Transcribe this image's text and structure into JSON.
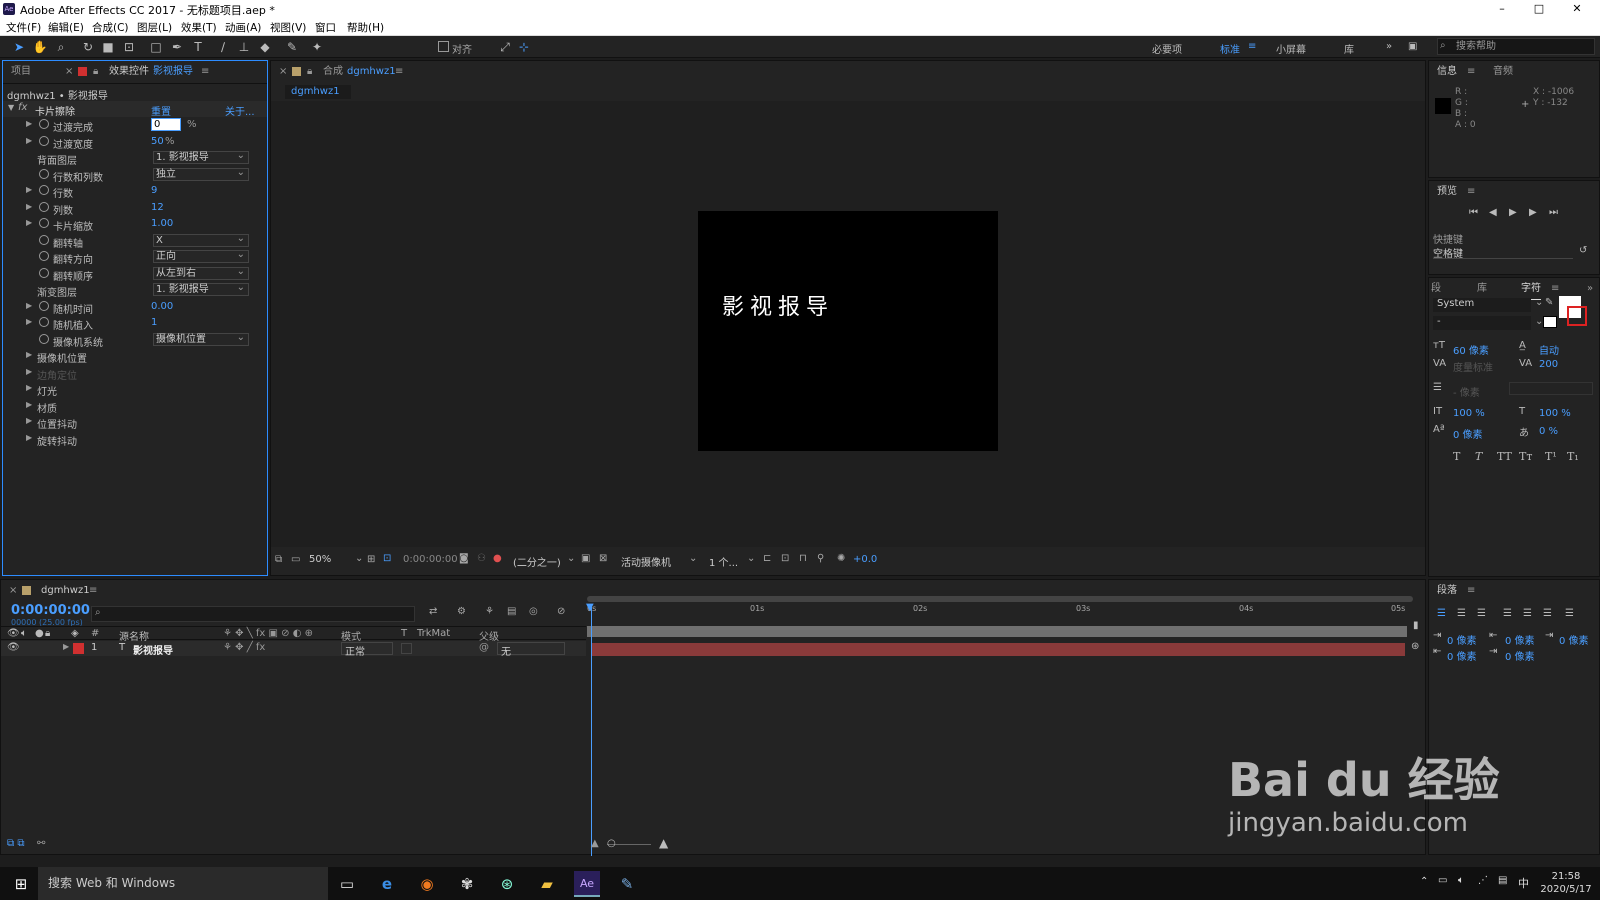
{
  "window": {
    "title": "Adobe After Effects CC 2017 - 无标题项目.aep *",
    "app_icon": "Ae",
    "min": "–",
    "max": "□",
    "close": "✕"
  },
  "menu": [
    "文件(F)",
    "编辑(E)",
    "合成(C)",
    "图层(L)",
    "效果(T)",
    "动画(A)",
    "视图(V)",
    "窗口",
    "帮助(H)"
  ],
  "toolbar": {
    "snap_label": "对齐",
    "workspaces": [
      "必要项",
      "标准",
      "小屏幕",
      "库"
    ],
    "active_workspace": "标准",
    "search_placeholder": "搜索帮助"
  },
  "left_panel": {
    "tab_project": "项目",
    "tab_effects": "效果控件",
    "tab_effects_layer": "影视报导",
    "breadcrumb": "dgmhwz1 • 影视报导",
    "effect_name": "卡片擦除",
    "reset": "重置",
    "about": "关于...",
    "properties": [
      {
        "label": "过渡完成",
        "value": "0",
        "unit": "%",
        "twirl": true,
        "stopwatch": true,
        "editing": true
      },
      {
        "label": "过渡宽度",
        "value": "50",
        "unit": "%",
        "twirl": true,
        "stopwatch": true
      },
      {
        "label": "背面图层",
        "dropdown": "1. 影视报导",
        "twirl": false,
        "stopwatch": false
      },
      {
        "label": "行数和列数",
        "dropdown": "独立",
        "twirl": false,
        "stopwatch": true
      },
      {
        "label": "行数",
        "value": "9",
        "twirl": true,
        "stopwatch": true
      },
      {
        "label": "列数",
        "value": "12",
        "twirl": true,
        "stopwatch": true
      },
      {
        "label": "卡片缩放",
        "value": "1.00",
        "twirl": true,
        "stopwatch": true
      },
      {
        "label": "翻转轴",
        "dropdown": "X",
        "twirl": false,
        "stopwatch": true
      },
      {
        "label": "翻转方向",
        "dropdown": "正向",
        "twirl": false,
        "stopwatch": true
      },
      {
        "label": "翻转顺序",
        "dropdown": "从左到右",
        "twirl": false,
        "stopwatch": true
      },
      {
        "label": "渐变图层",
        "dropdown": "1. 影视报导",
        "twirl": false,
        "stopwatch": false
      },
      {
        "label": "随机时间",
        "value": "0.00",
        "twirl": true,
        "stopwatch": true
      },
      {
        "label": "随机植入",
        "value": "1",
        "twirl": true,
        "stopwatch": true
      },
      {
        "label": "摄像机系统",
        "dropdown": "摄像机位置",
        "twirl": false,
        "stopwatch": true
      },
      {
        "label": "摄像机位置",
        "twirl": true,
        "group": true
      },
      {
        "label": "边角定位",
        "twirl": true,
        "group": true,
        "disabled": true
      },
      {
        "label": "灯光",
        "twirl": true,
        "group": true
      },
      {
        "label": "材质",
        "twirl": true,
        "group": true
      },
      {
        "label": "位置抖动",
        "twirl": true,
        "group": true
      },
      {
        "label": "旋转抖动",
        "twirl": true,
        "group": true
      }
    ]
  },
  "comp": {
    "tab_prefix": "合成",
    "name": "dgmhwz1",
    "subtab": "dgmhwz1",
    "text": "影视报导",
    "zoom": "50%",
    "timecode": "0:00:00:00",
    "resolution": "(二分之一)",
    "camera": "活动摄像机",
    "views": "1 个...",
    "exposure": "+0.0"
  },
  "info_panel": {
    "tab_info": "信息",
    "tab_audio": "音频",
    "rgba": [
      "R :",
      "G :",
      "B :",
      "A : 0"
    ],
    "x": "X : -1006",
    "y": "Y : -132"
  },
  "preview_panel": {
    "title": "预览",
    "shortcut_label": "快捷键",
    "shortcut_value": "空格键"
  },
  "character_panel": {
    "tabs": [
      "段",
      "库",
      "字符"
    ],
    "font": "System",
    "style": "-",
    "size": "60 像素",
    "leading": "自动",
    "kerning": "度量标准",
    "tracking": "200",
    "stroke": "- 像素",
    "vscale": "100 %",
    "hscale": "100 %",
    "baseline": "0 像素",
    "tsume": "0 %",
    "styles": [
      "T",
      "T",
      "TT",
      "Tт",
      "T¹",
      "T₁"
    ]
  },
  "paragraph_panel": {
    "title": "段落",
    "indents": [
      "0 像素",
      "0 像素",
      "0 像素",
      "0 像素",
      "0 像素"
    ]
  },
  "timeline": {
    "comp_name": "dgmhwz1",
    "timecode": "0:00:00:00",
    "fps": "00000 (25.00 fps)",
    "columns": [
      "#",
      "源名称",
      "模式",
      "T",
      "TrkMat",
      "父级"
    ],
    "ruler": [
      "0s",
      "01s",
      "02s",
      "03s",
      "04s",
      "05s"
    ],
    "layers": [
      {
        "num": "1",
        "type": "T",
        "name": "影视报导",
        "mode": "正常",
        "parent": "无"
      }
    ]
  },
  "taskbar": {
    "search": "搜索 Web 和 Windows",
    "time": "21:58",
    "date": "2020/5/17",
    "ime": "中"
  },
  "watermark": {
    "brand": "Bai du 经验",
    "url": "jingyan.baidu.com"
  }
}
